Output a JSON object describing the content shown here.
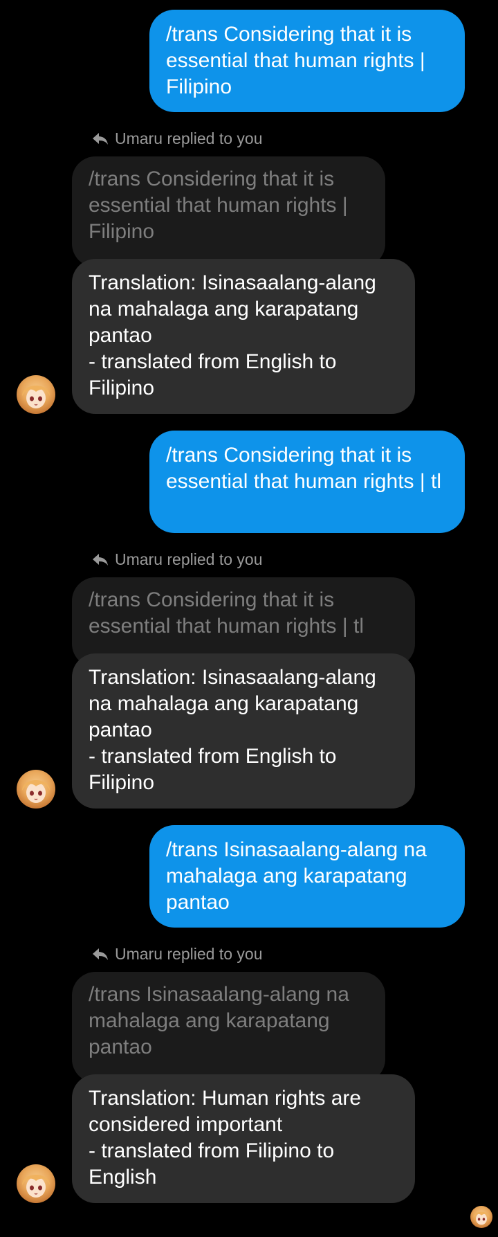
{
  "conversation": {
    "messages": [
      {
        "outgoing_text": "/trans Considering that it is essential that human rights | Filipino",
        "reply_label": "Umaru replied to you",
        "quoted_text": "/trans Considering that it is essential that human rights | Filipino",
        "reply_text": "Translation: Isinasaalang-alang na mahalaga ang karapatang pantao\n- translated from English to Filipino"
      },
      {
        "outgoing_text": "/trans Considering that it is essential that human rights | tl",
        "reply_label": "Umaru replied to you",
        "quoted_text": "/trans Considering that it is essential that human rights | tl",
        "reply_text": "Translation: Isinasaalang-alang na mahalaga ang karapatang pantao\n- translated from English to Filipino"
      },
      {
        "outgoing_text": "/trans Isinasaalang-alang na mahalaga ang karapatang pantao",
        "reply_label": "Umaru replied to you",
        "quoted_text": "/trans Isinasaalang-alang na mahalaga ang karapatang pantao",
        "reply_text": "Translation: Human rights are considered important\n- translated from Filipino to English"
      }
    ]
  },
  "colors": {
    "background": "#000000",
    "outgoing_bubble": "#0e93ea",
    "incoming_bubble": "#2e2e2e",
    "quoted_bubble": "#1b1b1b",
    "muted_text": "#9a9a9a"
  },
  "icons": {
    "reply": "reply-arrow-icon",
    "avatar": "bot-avatar-icon",
    "seen": "seen-avatar-icon"
  }
}
